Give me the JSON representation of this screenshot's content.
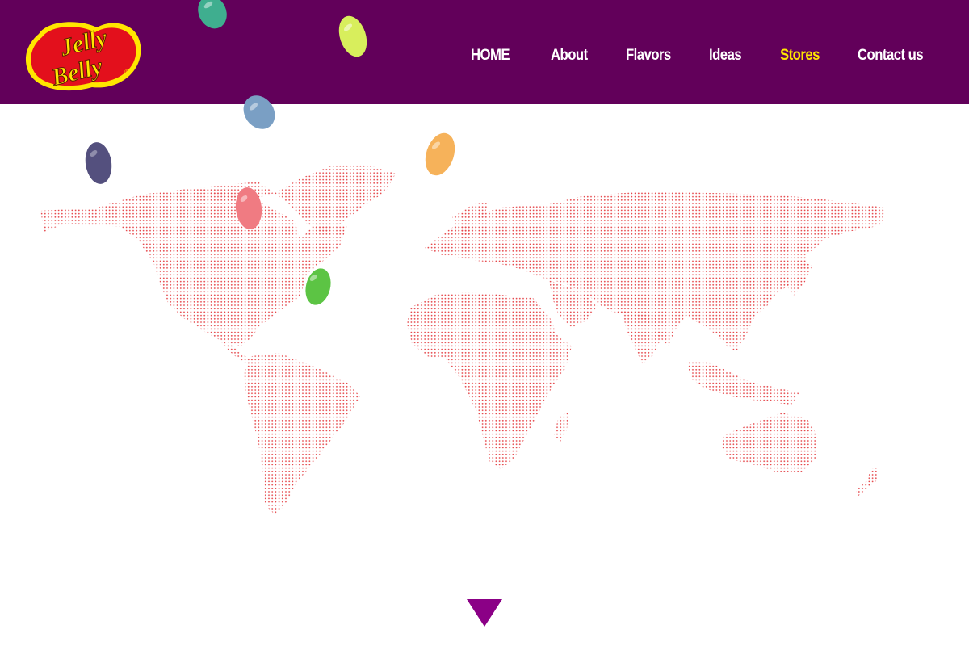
{
  "brand": {
    "logo_line1": "Jelly",
    "logo_line2": "Belly",
    "logo_mark": "®"
  },
  "nav": {
    "items": [
      {
        "label": "HOME",
        "name": "nav-home",
        "active": false
      },
      {
        "label": "About",
        "name": "nav-about",
        "active": false
      },
      {
        "label": "Flavors",
        "name": "nav-flavors",
        "active": false
      },
      {
        "label": "Ideas",
        "name": "nav-ideas",
        "active": false
      },
      {
        "label": "Stores",
        "name": "nav-stores",
        "active": true
      },
      {
        "label": "Contact us",
        "name": "nav-contact-us",
        "active": false
      }
    ]
  },
  "colors": {
    "header": "#62005a",
    "nav_text": "#ffffff",
    "nav_active": "#ffe600",
    "map_dots": "#e5474b",
    "arrow": "#8b0086",
    "logo_red": "#e3101c",
    "logo_yellow": "#ffe600"
  },
  "beans": [
    {
      "name": "teal-jelly-bean",
      "color": "#3fae8f"
    },
    {
      "name": "lime-jelly-bean",
      "color": "#d8ee5c"
    },
    {
      "name": "blue-jelly-bean",
      "color": "#7a9fc4"
    },
    {
      "name": "orange-jelly-bean",
      "color": "#f6b25a"
    },
    {
      "name": "purple-jelly-bean",
      "color": "#54507e"
    },
    {
      "name": "pink-jelly-bean",
      "color": "#f07b82"
    },
    {
      "name": "green-jelly-bean",
      "color": "#5cc444"
    }
  ],
  "icons": {
    "scroll_down": "triangle-down-icon"
  }
}
